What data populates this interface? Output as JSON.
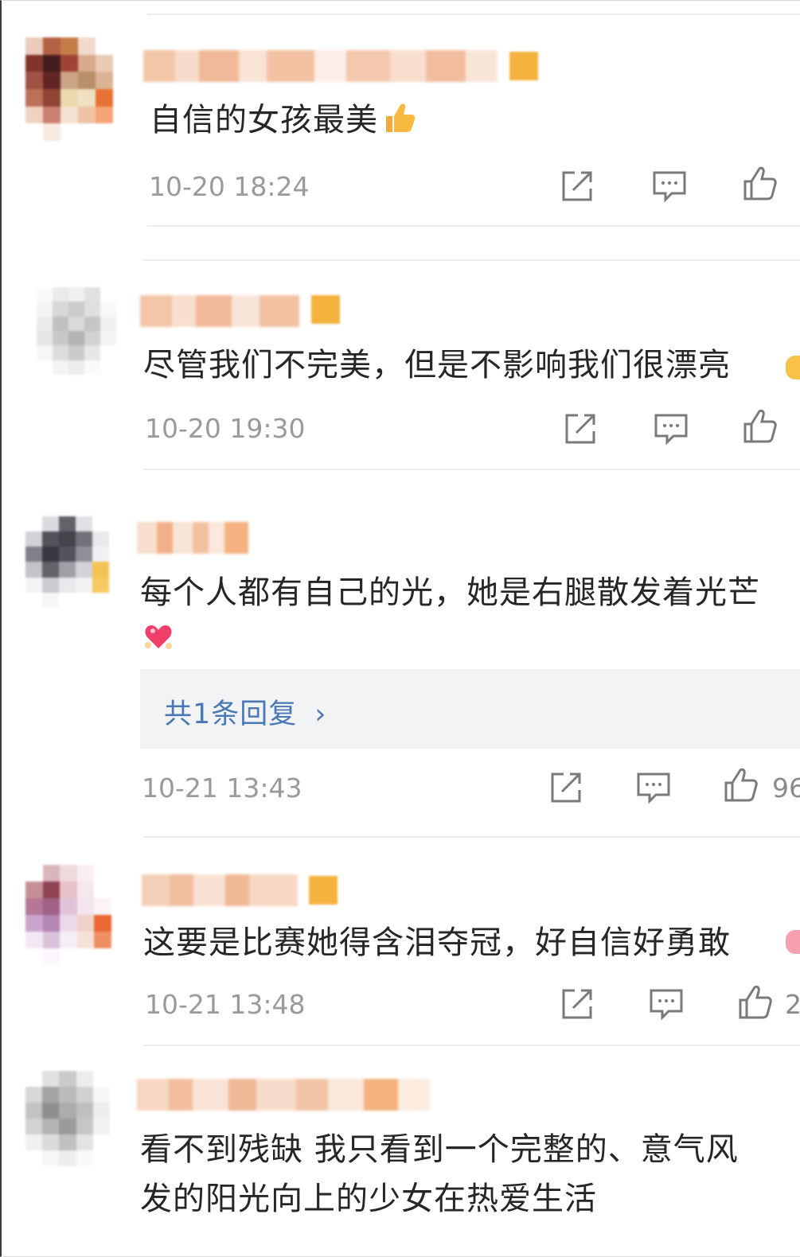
{
  "comments": [
    {
      "text": "自信的女孩最美",
      "emoji": "thumbs-up",
      "time": "10-20 18:24",
      "likes": ""
    },
    {
      "text": "尽管我们不完美，但是不影响我们很漂亮",
      "time": "10-20 19:30",
      "likes": ""
    },
    {
      "text": "每个人都有自己的光，她是右腿散发着光芒",
      "emoji": "heart",
      "replies_label": "共1条回复",
      "replies_chevron": "›",
      "time": "10-21 13:43",
      "likes": "96"
    },
    {
      "text": "这要是比赛她得含泪夺冠，好自信好勇敢",
      "time": "10-21 13:48",
      "likes": "2"
    },
    {
      "text_line1": "看不到残缺 我只看到一个完整的、意气风",
      "text_line2": "发的阳光向上的少女在热爱生活"
    }
  ],
  "icons": {
    "share": "share-icon",
    "comment": "comment-icon",
    "like": "thumbs-up-icon"
  },
  "colors": {
    "time": "#9a9a9a",
    "reply_link": "#4a78b4",
    "reply_bg": "#f2f3f5",
    "vip_badge": "#f4b23e"
  }
}
